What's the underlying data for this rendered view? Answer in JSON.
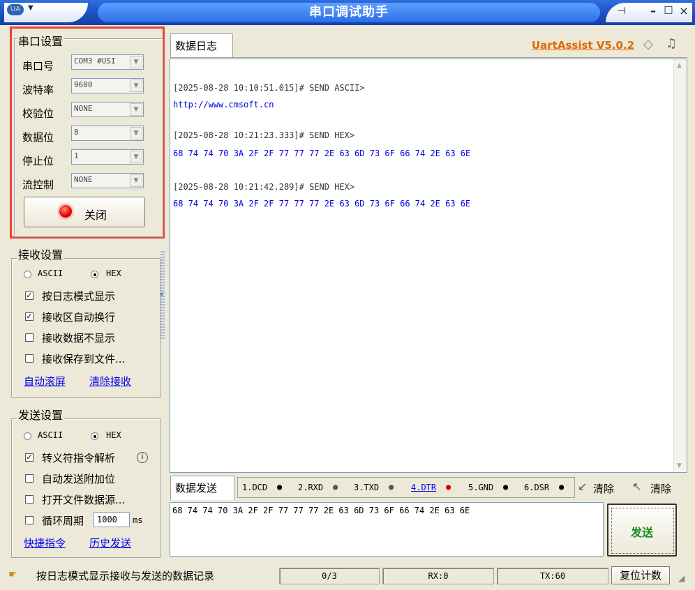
{
  "window": {
    "title": "串口调试助手",
    "sys_icon": "UA",
    "pin_icon": "pin-icon",
    "min_label": "–",
    "max_label": "□",
    "close_label": "×"
  },
  "serial": {
    "legend": "串口设置",
    "rows": [
      {
        "label": "串口号",
        "value": "COM3 #USI"
      },
      {
        "label": "波特率",
        "value": "9600"
      },
      {
        "label": "校验位",
        "value": "NONE"
      },
      {
        "label": "数据位",
        "value": "8"
      },
      {
        "label": "停止位",
        "value": "1"
      },
      {
        "label": "流控制",
        "value": "NONE"
      }
    ],
    "close_button": "关闭",
    "highlight_color": "#e8443a"
  },
  "receive": {
    "legend": "接收设置",
    "mode_ascii": "ASCII",
    "mode_hex": "HEX",
    "selected_mode": "HEX",
    "options": [
      {
        "label": "按日志模式显示",
        "checked": true
      },
      {
        "label": "接收区自动换行",
        "checked": true
      },
      {
        "label": "接收数据不显示",
        "checked": false
      },
      {
        "label": "接收保存到文件...",
        "checked": false
      }
    ],
    "link_autoscroll": "自动滚屏",
    "link_clear": "清除接收"
  },
  "send": {
    "legend": "发送设置",
    "mode_ascii": "ASCII",
    "mode_hex": "HEX",
    "selected_mode": "HEX",
    "options": [
      {
        "label": "转义符指令解析",
        "checked": true
      },
      {
        "label": "自动发送附加位",
        "checked": false
      },
      {
        "label": "打开文件数据源...",
        "checked": false
      }
    ],
    "cycle_label": "循环周期",
    "cycle_value": "1000",
    "cycle_unit": "ms",
    "link_shortcuts": "快捷指令",
    "link_history": "历史发送"
  },
  "log": {
    "tab_label": "数据日志",
    "brand": "UartAssist V5.0.2",
    "entries": [
      {
        "head": "[2025-08-28 10:10:51.015]# SEND ASCII>",
        "data": "http://www.cmsoft.cn"
      },
      {
        "head": "[2025-08-28 10:21:23.333]# SEND HEX>",
        "data": "68 74 74 70 3A 2F 2F 77 77 77 2E 63 6D 73 6F 66 74 2E 63 6E"
      },
      {
        "head": "[2025-08-28 10:21:42.289]# SEND HEX>",
        "data": "68 74 74 70 3A 2F 2F 77 77 77 2E 63 6D 73 6F 66 74 2E 63 6E"
      }
    ]
  },
  "sendbar": {
    "tab_label": "数据发送",
    "signals": [
      {
        "label": "1.DCD",
        "dot": "#000000"
      },
      {
        "label": "2.RXD",
        "dot": "#555555"
      },
      {
        "label": "3.TXD",
        "dot": "#555555"
      },
      {
        "label": "4.DTR",
        "dot": "#dd0000",
        "active": true
      },
      {
        "label": "5.GND",
        "dot": "#000000"
      },
      {
        "label": "6.DSR",
        "dot": "#000000"
      }
    ],
    "clear1": "清除",
    "clear2": "清除",
    "input_value": "68 74 74 70 3A 2F 2F 77 77 77 2E 63 6D 73 6F 66 74 2E 63 6E",
    "send_button": "发送"
  },
  "status": {
    "message": "按日志模式显示接收与发送的数据记录",
    "count": "0/3",
    "rx": "RX:0",
    "tx": "TX:60",
    "reset": "复位计数"
  }
}
